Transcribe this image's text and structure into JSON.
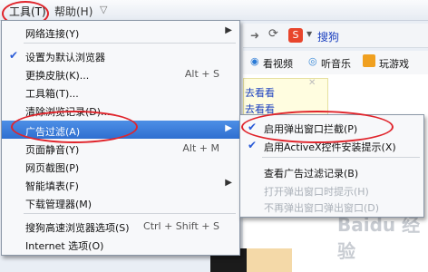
{
  "menubar": {
    "tools": "工具(T)",
    "help": "帮助(H)"
  },
  "background": {
    "addr_label": "搜狗",
    "toolbar_items": [
      "看视频",
      "听音乐",
      "玩游戏"
    ],
    "links": [
      "去看看",
      "去看看"
    ]
  },
  "tools_menu": {
    "items": [
      {
        "label": "网络连接(Y)",
        "shortcut": "",
        "submenu": true
      },
      {
        "label": "设置为默认浏览器",
        "shortcut": "",
        "checked": true
      },
      {
        "label": "更换皮肤(K)...",
        "shortcut": "Alt + S"
      },
      {
        "label": "工具箱(T)...",
        "shortcut": ""
      },
      {
        "label": "清除浏览记录(D)...",
        "shortcut": ""
      },
      {
        "label": "广告过滤(A)",
        "shortcut": "",
        "submenu": true
      },
      {
        "label": "页面静音(Y)",
        "shortcut": "Alt + M"
      },
      {
        "label": "网页截图(P)",
        "shortcut": ""
      },
      {
        "label": "智能填表(F)",
        "shortcut": "",
        "submenu": true
      },
      {
        "label": "下载管理器(M)",
        "shortcut": ""
      },
      {
        "label": "搜狗高速浏览器选项(S)",
        "shortcut": "Ctrl + Shift + S"
      },
      {
        "label": "Internet 选项(O)",
        "shortcut": ""
      }
    ]
  },
  "ad_submenu": {
    "items": [
      {
        "label": "启用弹出窗口拦截(P)",
        "checked": true
      },
      {
        "label": "启用ActiveX控件安装提示(X)",
        "checked": true
      },
      {
        "label": "查看广告过滤记录(B)"
      },
      {
        "label": "打开弹出窗口时提示(H)",
        "disabled": true
      },
      {
        "label": "不再弹出窗口弹出窗口(D)",
        "disabled": true
      }
    ]
  },
  "watermark": "Baidu 经验",
  "colors": {
    "highlight": "#2f6fd0",
    "annotation": "#e0242b"
  }
}
